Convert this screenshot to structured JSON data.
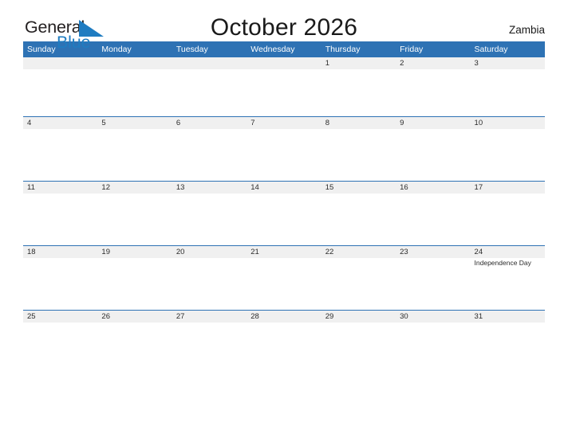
{
  "brand": {
    "word_one": "General",
    "word_two": "Blue",
    "flag_icon": "triangle-flag-icon",
    "colors": {
      "dark_text": "#231f20",
      "blue_text": "#1f7cc1",
      "header_blue": "#2e72b4",
      "band_gray": "#f0f0f0"
    }
  },
  "header": {
    "title": "October 2026",
    "country": "Zambia"
  },
  "calendar": {
    "weekday_headers": [
      "Sunday",
      "Monday",
      "Tuesday",
      "Wednesday",
      "Thursday",
      "Friday",
      "Saturday"
    ],
    "weeks": [
      {
        "days": [
          {
            "date": "",
            "events": []
          },
          {
            "date": "",
            "events": []
          },
          {
            "date": "",
            "events": []
          },
          {
            "date": "",
            "events": []
          },
          {
            "date": "1",
            "events": []
          },
          {
            "date": "2",
            "events": []
          },
          {
            "date": "3",
            "events": []
          }
        ]
      },
      {
        "days": [
          {
            "date": "4",
            "events": []
          },
          {
            "date": "5",
            "events": []
          },
          {
            "date": "6",
            "events": []
          },
          {
            "date": "7",
            "events": []
          },
          {
            "date": "8",
            "events": []
          },
          {
            "date": "9",
            "events": []
          },
          {
            "date": "10",
            "events": []
          }
        ]
      },
      {
        "days": [
          {
            "date": "11",
            "events": []
          },
          {
            "date": "12",
            "events": []
          },
          {
            "date": "13",
            "events": []
          },
          {
            "date": "14",
            "events": []
          },
          {
            "date": "15",
            "events": []
          },
          {
            "date": "16",
            "events": []
          },
          {
            "date": "17",
            "events": []
          }
        ]
      },
      {
        "days": [
          {
            "date": "18",
            "events": []
          },
          {
            "date": "19",
            "events": []
          },
          {
            "date": "20",
            "events": []
          },
          {
            "date": "21",
            "events": []
          },
          {
            "date": "22",
            "events": []
          },
          {
            "date": "23",
            "events": []
          },
          {
            "date": "24",
            "events": [
              "Independence Day"
            ]
          }
        ]
      },
      {
        "days": [
          {
            "date": "25",
            "events": []
          },
          {
            "date": "26",
            "events": []
          },
          {
            "date": "27",
            "events": []
          },
          {
            "date": "28",
            "events": []
          },
          {
            "date": "29",
            "events": []
          },
          {
            "date": "30",
            "events": []
          },
          {
            "date": "31",
            "events": []
          }
        ]
      }
    ]
  }
}
